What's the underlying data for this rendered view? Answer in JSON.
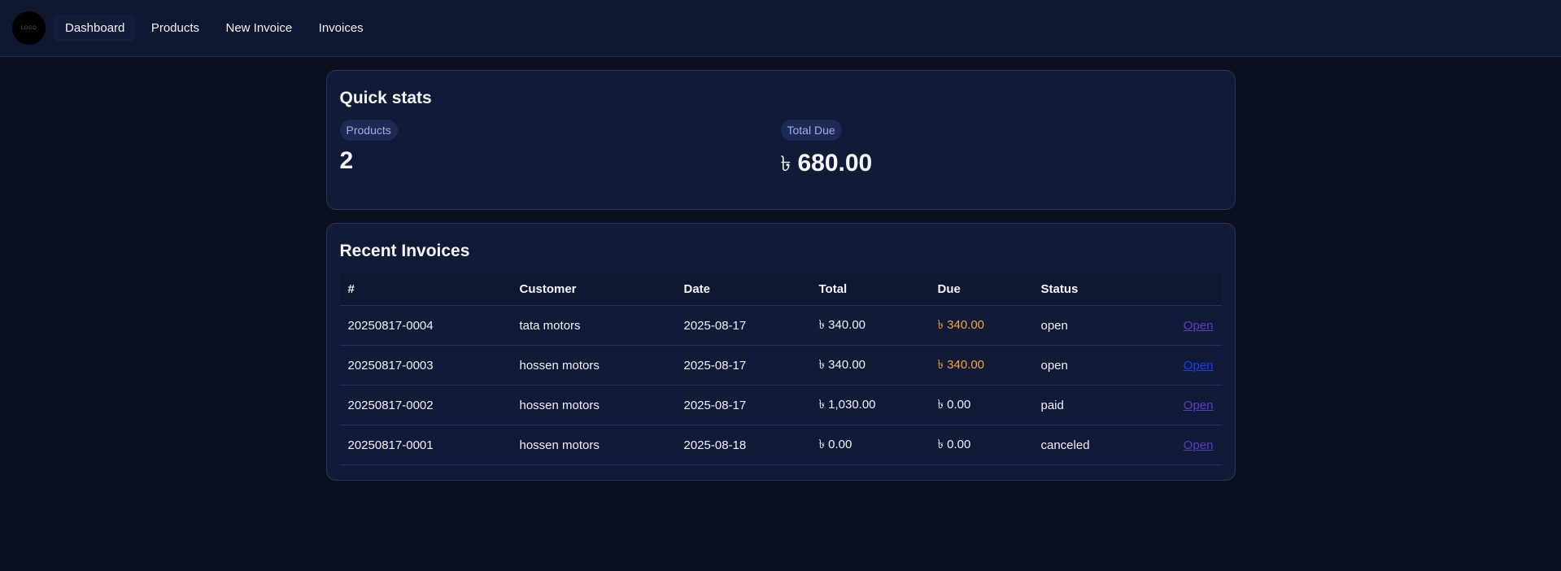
{
  "app": {
    "logo_text": "LOGO"
  },
  "nav": {
    "items": [
      {
        "label": "Dashboard"
      },
      {
        "label": "Products"
      },
      {
        "label": "New Invoice"
      },
      {
        "label": "Invoices"
      }
    ]
  },
  "quick_stats": {
    "title": "Quick stats",
    "products": {
      "label": "Products",
      "value": "2"
    },
    "total_due": {
      "label": "Total Due",
      "currency": "৳",
      "value": "680.00"
    }
  },
  "recent_invoices": {
    "title": "Recent Invoices",
    "columns": [
      "#",
      "Customer",
      "Date",
      "Total",
      "Due",
      "Status"
    ],
    "rows": [
      {
        "number": "20250817-0004",
        "customer": "tata motors",
        "date": "2025-08-17",
        "total": "৳ 340.00",
        "due": "৳ 340.00",
        "status": "open",
        "action": "Open"
      },
      {
        "number": "20250817-0003",
        "customer": "hossen motors",
        "date": "2025-08-17",
        "total": "৳ 340.00",
        "due": "৳ 340.00",
        "status": "open",
        "action": "Open"
      },
      {
        "number": "20250817-0002",
        "customer": "hossen motors",
        "date": "2025-08-17",
        "total": "৳ 1,030.00",
        "due": "৳ 0.00",
        "status": "paid",
        "action": "Open"
      },
      {
        "number": "20250817-0001",
        "customer": "hossen motors",
        "date": "2025-08-18",
        "total": "৳ 0.00",
        "due": "৳ 0.00",
        "status": "canceled",
        "action": "Open"
      }
    ]
  },
  "colors": {
    "background": "#0a0f1e",
    "card": "#111a36",
    "due_open": "#f5a43a",
    "link": "#5a3ec8",
    "link_hover": "#1f3df0"
  }
}
